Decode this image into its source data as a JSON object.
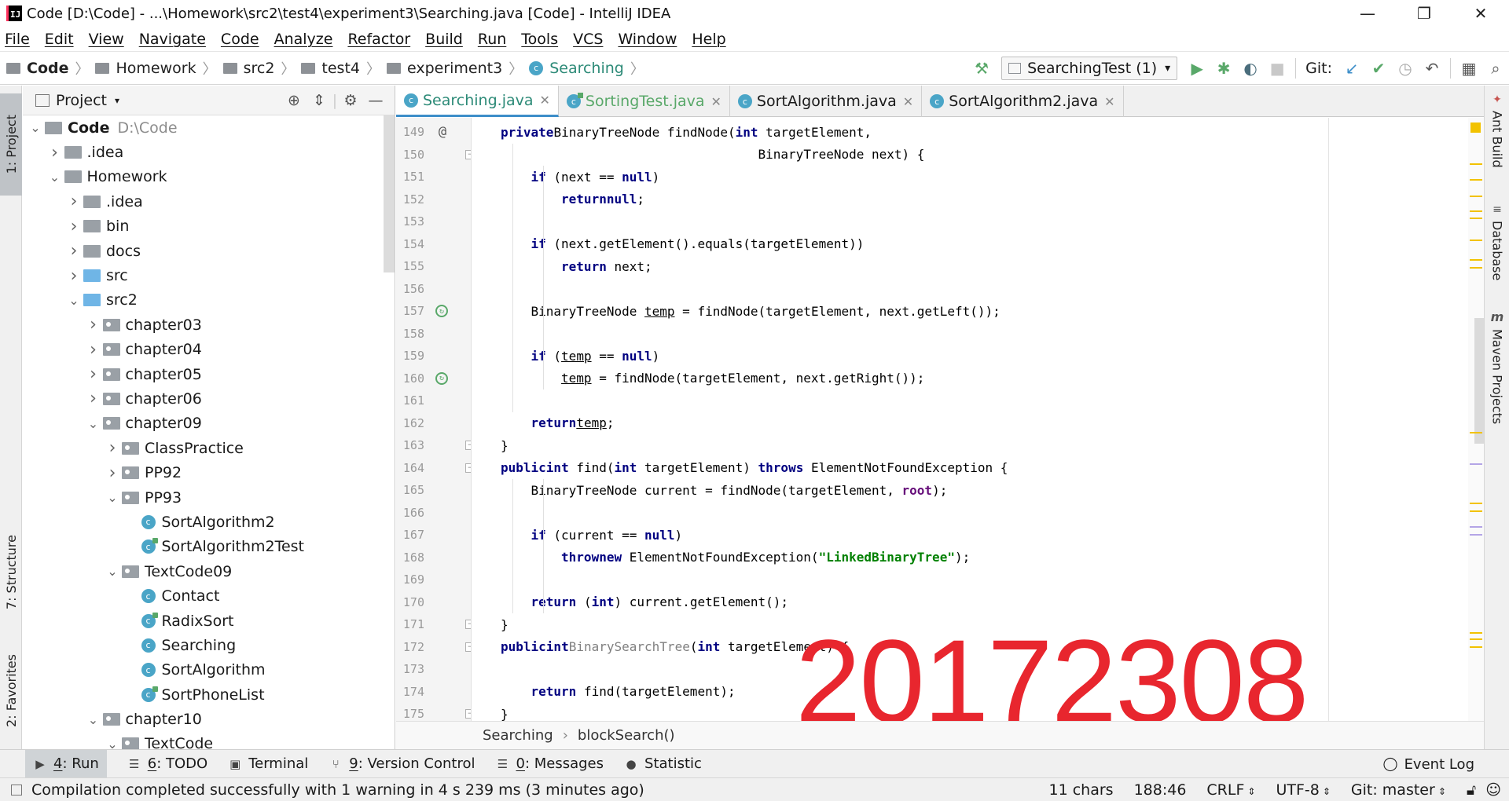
{
  "window": {
    "title": "Code [D:\\Code] - ...\\Homework\\src2\\test4\\experiment3\\Searching.java [Code] - IntelliJ IDEA",
    "app_icon_text": "IJ",
    "controls": [
      "—",
      "❐",
      "✕"
    ]
  },
  "menu": [
    "File",
    "Edit",
    "View",
    "Navigate",
    "Code",
    "Analyze",
    "Refactor",
    "Build",
    "Run",
    "Tools",
    "VCS",
    "Window",
    "Help"
  ],
  "breadcrumb": [
    "Code",
    "Homework",
    "src2",
    "test4",
    "experiment3",
    "Searching"
  ],
  "toolbar": {
    "run_config": "SearchingTest (1)",
    "git_label": "Git:"
  },
  "left_tools": {
    "project": "1: Project",
    "structure": "7: Structure",
    "favorites": "2: Favorites"
  },
  "project_panel": {
    "title": "Project",
    "tree": [
      {
        "label": "Code",
        "sub": "D:\\Code",
        "depth": 0,
        "arrow": "down",
        "kind": "module",
        "bold": true
      },
      {
        "label": ".idea",
        "depth": 1,
        "arrow": "right",
        "kind": "folder"
      },
      {
        "label": "Homework",
        "depth": 1,
        "arrow": "down",
        "kind": "folder"
      },
      {
        "label": ".idea",
        "depth": 2,
        "arrow": "right",
        "kind": "folder"
      },
      {
        "label": "bin",
        "depth": 2,
        "arrow": "right",
        "kind": "folder"
      },
      {
        "label": "docs",
        "depth": 2,
        "arrow": "right",
        "kind": "folder"
      },
      {
        "label": "src",
        "depth": 2,
        "arrow": "right",
        "kind": "source"
      },
      {
        "label": "src2",
        "depth": 2,
        "arrow": "down",
        "kind": "source"
      },
      {
        "label": "chapter03",
        "depth": 3,
        "arrow": "right",
        "kind": "package"
      },
      {
        "label": "chapter04",
        "depth": 3,
        "arrow": "right",
        "kind": "package"
      },
      {
        "label": "chapter05",
        "depth": 3,
        "arrow": "right",
        "kind": "package"
      },
      {
        "label": "chapter06",
        "depth": 3,
        "arrow": "right",
        "kind": "package"
      },
      {
        "label": "chapter09",
        "depth": 3,
        "arrow": "down",
        "kind": "package"
      },
      {
        "label": "ClassPractice",
        "depth": 4,
        "arrow": "right",
        "kind": "package"
      },
      {
        "label": "PP92",
        "depth": 4,
        "arrow": "right",
        "kind": "package"
      },
      {
        "label": "PP93",
        "depth": 4,
        "arrow": "down",
        "kind": "package"
      },
      {
        "label": "SortAlgorithm2",
        "depth": 5,
        "arrow": "none",
        "kind": "class"
      },
      {
        "label": "SortAlgorithm2Test",
        "depth": 5,
        "arrow": "none",
        "kind": "test"
      },
      {
        "label": "TextCode09",
        "depth": 4,
        "arrow": "down",
        "kind": "package"
      },
      {
        "label": "Contact",
        "depth": 5,
        "arrow": "none",
        "kind": "class"
      },
      {
        "label": "RadixSort",
        "depth": 5,
        "arrow": "none",
        "kind": "test"
      },
      {
        "label": "Searching",
        "depth": 5,
        "arrow": "none",
        "kind": "class"
      },
      {
        "label": "SortAlgorithm",
        "depth": 5,
        "arrow": "none",
        "kind": "class"
      },
      {
        "label": "SortPhoneList",
        "depth": 5,
        "arrow": "none",
        "kind": "test"
      },
      {
        "label": "chapter10",
        "depth": 3,
        "arrow": "down",
        "kind": "package"
      },
      {
        "label": "TextCode",
        "depth": 4,
        "arrow": "down",
        "kind": "package"
      }
    ]
  },
  "editor_tabs": [
    {
      "label": "Searching.java",
      "active": true,
      "test": false,
      "modified": false
    },
    {
      "label": "SortingTest.java",
      "active": false,
      "test": true,
      "modified": true
    },
    {
      "label": "SortAlgorithm.java",
      "active": false,
      "test": false,
      "modified": false
    },
    {
      "label": "SortAlgorithm2.java",
      "active": false,
      "test": false,
      "modified": false
    }
  ],
  "editor": {
    "lines": [
      {
        "n": "149",
        "mark": "@",
        "indent": 1,
        "fold": false,
        "tokens": [
          [
            "kw",
            "private"
          ],
          [
            "",
            "BinaryTreeNode findNode("
          ],
          [
            "kw",
            "int"
          ],
          [
            "",
            " targetElement,"
          ]
        ]
      },
      {
        "n": "150",
        "mark": "",
        "indent": 0,
        "fold": true,
        "tokens": [
          [
            "",
            "                                  BinaryTreeNode next) {"
          ]
        ]
      },
      {
        "n": "151",
        "mark": "",
        "indent": 2,
        "fold": false,
        "tokens": [
          [
            "kw",
            "if"
          ],
          [
            "",
            " (next == "
          ],
          [
            "kw",
            "null"
          ],
          [
            "",
            ")"
          ]
        ]
      },
      {
        "n": "152",
        "mark": "",
        "indent": 3,
        "fold": false,
        "tokens": [
          [
            "kw",
            "return"
          ],
          [
            " ",
            ""
          ],
          [
            "kw",
            "null"
          ],
          [
            "",
            ";"
          ]
        ]
      },
      {
        "n": "153",
        "mark": "",
        "indent": 0,
        "fold": false,
        "tokens": []
      },
      {
        "n": "154",
        "mark": "",
        "indent": 2,
        "fold": false,
        "tokens": [
          [
            "kw",
            "if"
          ],
          [
            "",
            " (next.getElement().equals(targetElement))"
          ]
        ]
      },
      {
        "n": "155",
        "mark": "",
        "indent": 3,
        "fold": false,
        "tokens": [
          [
            "kw",
            "return"
          ],
          [
            "",
            " next;"
          ]
        ]
      },
      {
        "n": "156",
        "mark": "",
        "indent": 0,
        "fold": false,
        "tokens": []
      },
      {
        "n": "157",
        "mark": "rec",
        "indent": 2,
        "fold": false,
        "tokens": [
          [
            "",
            "BinaryTreeNode "
          ],
          [
            "uln",
            "temp"
          ],
          [
            "",
            " = findNode(targetElement, next.getLeft());"
          ]
        ]
      },
      {
        "n": "158",
        "mark": "",
        "indent": 0,
        "fold": false,
        "tokens": []
      },
      {
        "n": "159",
        "mark": "",
        "indent": 2,
        "fold": false,
        "tokens": [
          [
            "kw",
            "if"
          ],
          [
            "",
            " ("
          ],
          [
            "uln",
            "temp"
          ],
          [
            "",
            " == "
          ],
          [
            "kw",
            "null"
          ],
          [
            "",
            ")"
          ]
        ]
      },
      {
        "n": "160",
        "mark": "rec",
        "indent": 3,
        "fold": false,
        "tokens": [
          [
            "uln",
            "temp"
          ],
          [
            "",
            " = findNode(targetElement, next.getRight());"
          ]
        ]
      },
      {
        "n": "161",
        "mark": "",
        "indent": 0,
        "fold": false,
        "tokens": []
      },
      {
        "n": "162",
        "mark": "",
        "indent": 2,
        "fold": false,
        "tokens": [
          [
            "kw",
            "return"
          ],
          [
            " ",
            ""
          ],
          [
            "uln",
            "temp"
          ],
          [
            "",
            ";"
          ]
        ]
      },
      {
        "n": "163",
        "mark": "",
        "indent": 1,
        "fold": true,
        "tokens": [
          [
            "",
            "}"
          ]
        ]
      },
      {
        "n": "164",
        "mark": "",
        "indent": 1,
        "fold": true,
        "tokens": [
          [
            "kw",
            "public"
          ],
          [
            " ",
            ""
          ],
          [
            "kw",
            "int"
          ],
          [
            "",
            " find("
          ],
          [
            "kw",
            "int"
          ],
          [
            "",
            " targetElement) "
          ],
          [
            "kw",
            "throws"
          ],
          [
            "",
            " ElementNotFoundException {"
          ]
        ]
      },
      {
        "n": "165",
        "mark": "",
        "indent": 2,
        "fold": false,
        "tokens": [
          [
            "",
            "BinaryTreeNode current = findNode(targetElement, "
          ],
          [
            "fld",
            "root"
          ],
          [
            "",
            ");"
          ]
        ]
      },
      {
        "n": "166",
        "mark": "",
        "indent": 0,
        "fold": false,
        "tokens": []
      },
      {
        "n": "167",
        "mark": "",
        "indent": 2,
        "fold": false,
        "tokens": [
          [
            "kw",
            "if"
          ],
          [
            "",
            " (current == "
          ],
          [
            "kw",
            "null"
          ],
          [
            "",
            ")"
          ]
        ]
      },
      {
        "n": "168",
        "mark": "",
        "indent": 3,
        "fold": false,
        "tokens": [
          [
            "kw",
            "throw"
          ],
          [
            " ",
            ""
          ],
          [
            "kw",
            "new"
          ],
          [
            "",
            " ElementNotFoundException("
          ],
          [
            "str",
            "\"LinkedBinaryTree\""
          ],
          [
            "",
            ");"
          ]
        ]
      },
      {
        "n": "169",
        "mark": "",
        "indent": 0,
        "fold": false,
        "tokens": []
      },
      {
        "n": "170",
        "mark": "",
        "indent": 2,
        "fold": false,
        "tokens": [
          [
            "kw",
            "return"
          ],
          [
            "",
            " ("
          ],
          [
            "kw",
            "int"
          ],
          [
            "",
            ") current.getElement();"
          ]
        ]
      },
      {
        "n": "171",
        "mark": "",
        "indent": 1,
        "fold": true,
        "tokens": [
          [
            "",
            "}"
          ]
        ]
      },
      {
        "n": "172",
        "mark": "",
        "indent": 1,
        "fold": true,
        "tokens": [
          [
            "kw",
            "public"
          ],
          [
            " ",
            ""
          ],
          [
            "kw",
            "int"
          ],
          [
            " ",
            ""
          ],
          [
            "gry",
            "BinarySearchTree"
          ],
          [
            "",
            "("
          ],
          [
            "kw",
            "int"
          ],
          [
            "",
            " targetElement) {"
          ]
        ]
      },
      {
        "n": "173",
        "mark": "",
        "indent": 0,
        "fold": false,
        "tokens": []
      },
      {
        "n": "174",
        "mark": "",
        "indent": 2,
        "fold": false,
        "tokens": [
          [
            "kw",
            "return"
          ],
          [
            "",
            " find(targetElement);"
          ]
        ]
      },
      {
        "n": "175",
        "mark": "",
        "indent": 1,
        "fold": true,
        "tokens": [
          [
            "",
            "}"
          ]
        ]
      }
    ],
    "watermark": "20172308",
    "breadcrumb": [
      "Searching",
      "blockSearch()"
    ]
  },
  "right_tools": [
    "Ant Build",
    "Database",
    "Maven Projects"
  ],
  "bottom_tools": [
    {
      "key": "4",
      "label": ": Run",
      "icon": "▶",
      "active": true
    },
    {
      "key": "6",
      "label": ": TODO",
      "icon": "☰",
      "active": false
    },
    {
      "key": "",
      "label": "Terminal",
      "icon": "▣",
      "active": false
    },
    {
      "key": "9",
      "label": ": Version Control",
      "icon": "⑂",
      "active": false
    },
    {
      "key": "0",
      "label": ": Messages",
      "icon": "☰",
      "active": false
    },
    {
      "key": "",
      "label": "Statistic",
      "icon": "●",
      "active": false
    }
  ],
  "event_log": "Event Log",
  "status": {
    "message": "Compilation completed successfully with 1 warning in 4 s 239 ms (3 minutes ago)",
    "chars": "11 chars",
    "position": "188:46",
    "line_sep": "CRLF",
    "encoding": "UTF-8",
    "git": "Git: master"
  },
  "colors": {
    "accent": "#3d8ec9",
    "keyword": "#000080",
    "string": "#008000",
    "field": "#660e7a",
    "watermark": "#e8262e"
  }
}
